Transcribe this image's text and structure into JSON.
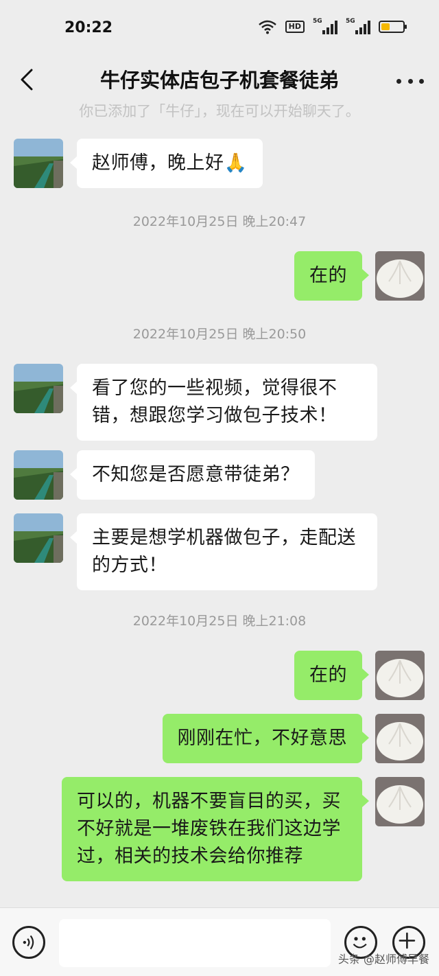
{
  "status": {
    "time": "20:22",
    "hd_label": "HD",
    "signal1_label": "5G",
    "signal2_label": "5G",
    "battery_level": 0.35,
    "battery_color": "#f5b800"
  },
  "nav": {
    "title": "牛仔实体店包子机套餐徒弟"
  },
  "chat": {
    "system_notice": "你已添加了「牛仔」，现在可以开始聊天了。",
    "timestamps": [
      "2022年10月25日 晚上20:47",
      "2022年10月25日 晚上20:50",
      "2022年10月25日 晚上21:08"
    ],
    "messages": [
      {
        "side": "in",
        "text": "赵师傅，晚上好🙏"
      },
      {
        "side": "out",
        "text": "在的"
      },
      {
        "side": "in",
        "text": "看了您的一些视频，觉得很不错，想跟您学习做包子技术！"
      },
      {
        "side": "in",
        "text": "不知您是否愿意带徒弟？"
      },
      {
        "side": "in",
        "text": "主要是想学机器做包子，走配送的方式！"
      },
      {
        "side": "out",
        "text": "在的"
      },
      {
        "side": "out",
        "text": "刚刚在忙，不好意思"
      },
      {
        "side": "out",
        "text": "可以的，机器不要盲目的买，买不好就是一堆废铁在我们这边学过，相关的技术会给你推荐"
      }
    ]
  },
  "input": {
    "placeholder": ""
  },
  "watermark": "头条 @赵师傅早餐",
  "colors": {
    "background": "#ededed",
    "incoming_bubble": "#ffffff",
    "outgoing_bubble": "#95ec69"
  },
  "icons": [
    "back-icon",
    "more-icon",
    "voice-icon",
    "emoji-icon",
    "plus-icon",
    "wifi-icon",
    "battery-icon"
  ]
}
